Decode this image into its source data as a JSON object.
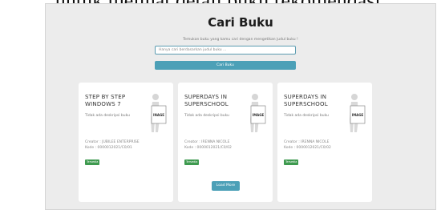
{
  "caption": "untuk melihat detail buku rekomendasi.",
  "header": {
    "title": "Cari Buku",
    "subtitle": "Temukan buku yang kamu cari dengan mengetikan judul buku !"
  },
  "search": {
    "placeholder": "Hanya cari berdasarkan judul buku ...",
    "button_label": "Cari Buku"
  },
  "books": [
    {
      "title": "STEP BY STEP WINDOWS 7",
      "description": "Tidak ada deskripsi buku",
      "creator": "Creator : JUBILEE ENTERPRISE",
      "code": "Kode : 0000012021/C0/01",
      "badge": "Tersedia",
      "image_text": "INAGE"
    },
    {
      "title": "SUPERDAYS IN SUPERSCHOOL",
      "description": "Tidak ada deskripsi buku",
      "creator": "Creator : IRENNA NICOLE",
      "code": "Kode : 0000012021/C0/02",
      "badge": "Tersedia",
      "image_text": "IMAGE"
    },
    {
      "title": "SUPERDAYS IN SUPERSCHOOL",
      "description": "Tidak ada deskripsi buku",
      "creator": "Creator : IRENNA NICOLE",
      "code": "Kode : 0000012021/C0/02",
      "badge": "Tersedia",
      "image_text": "IMAGE"
    }
  ],
  "load_more_label": "Load More",
  "colors": {
    "accent": "#4ca0b7",
    "badge": "#3e9a4f",
    "background": "#ececec"
  },
  "icons": {
    "placeholder_image": "figure-holding-image-sign-icon"
  }
}
